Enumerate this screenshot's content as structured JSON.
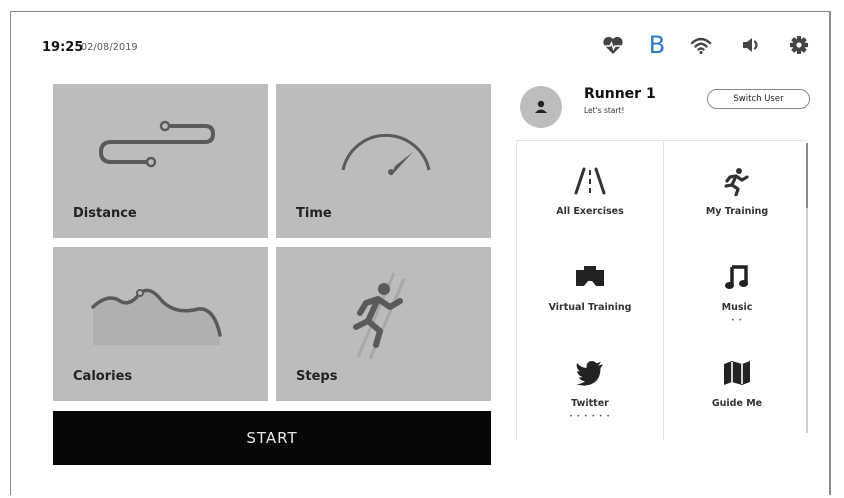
{
  "status": {
    "time": "19:25",
    "date": "02/08/2019",
    "icons": [
      "heart-rate-icon",
      "bluetooth-icon",
      "wifi-icon",
      "volume-icon",
      "gear-icon"
    ],
    "bluetooth_glyph": "B"
  },
  "tiles": {
    "distance": "Distance",
    "time": "Time",
    "calories": "Calories",
    "steps": "Steps"
  },
  "start_label": "START",
  "user": {
    "name": "Runner 1",
    "subtitle": "Let's start!",
    "switch_label": "Switch User"
  },
  "menu": [
    {
      "label": "All Exercises",
      "icon": "road-icon",
      "dots": ""
    },
    {
      "label": "My Training",
      "icon": "runner-icon",
      "dots": ""
    },
    {
      "label": "Virtual Training",
      "icon": "vr-headset-icon",
      "dots": ""
    },
    {
      "label": "Music",
      "icon": "music-note-icon",
      "dots": "• •"
    },
    {
      "label": "Twitter",
      "icon": "twitter-icon",
      "dots": "• • • • • •"
    },
    {
      "label": "Guide Me",
      "icon": "map-icon",
      "dots": ""
    }
  ],
  "colors": {
    "tile_bg": "#bcbcbc",
    "start_bg": "#070707",
    "icon": "#444444",
    "bluetooth": "#2b7bc9"
  }
}
